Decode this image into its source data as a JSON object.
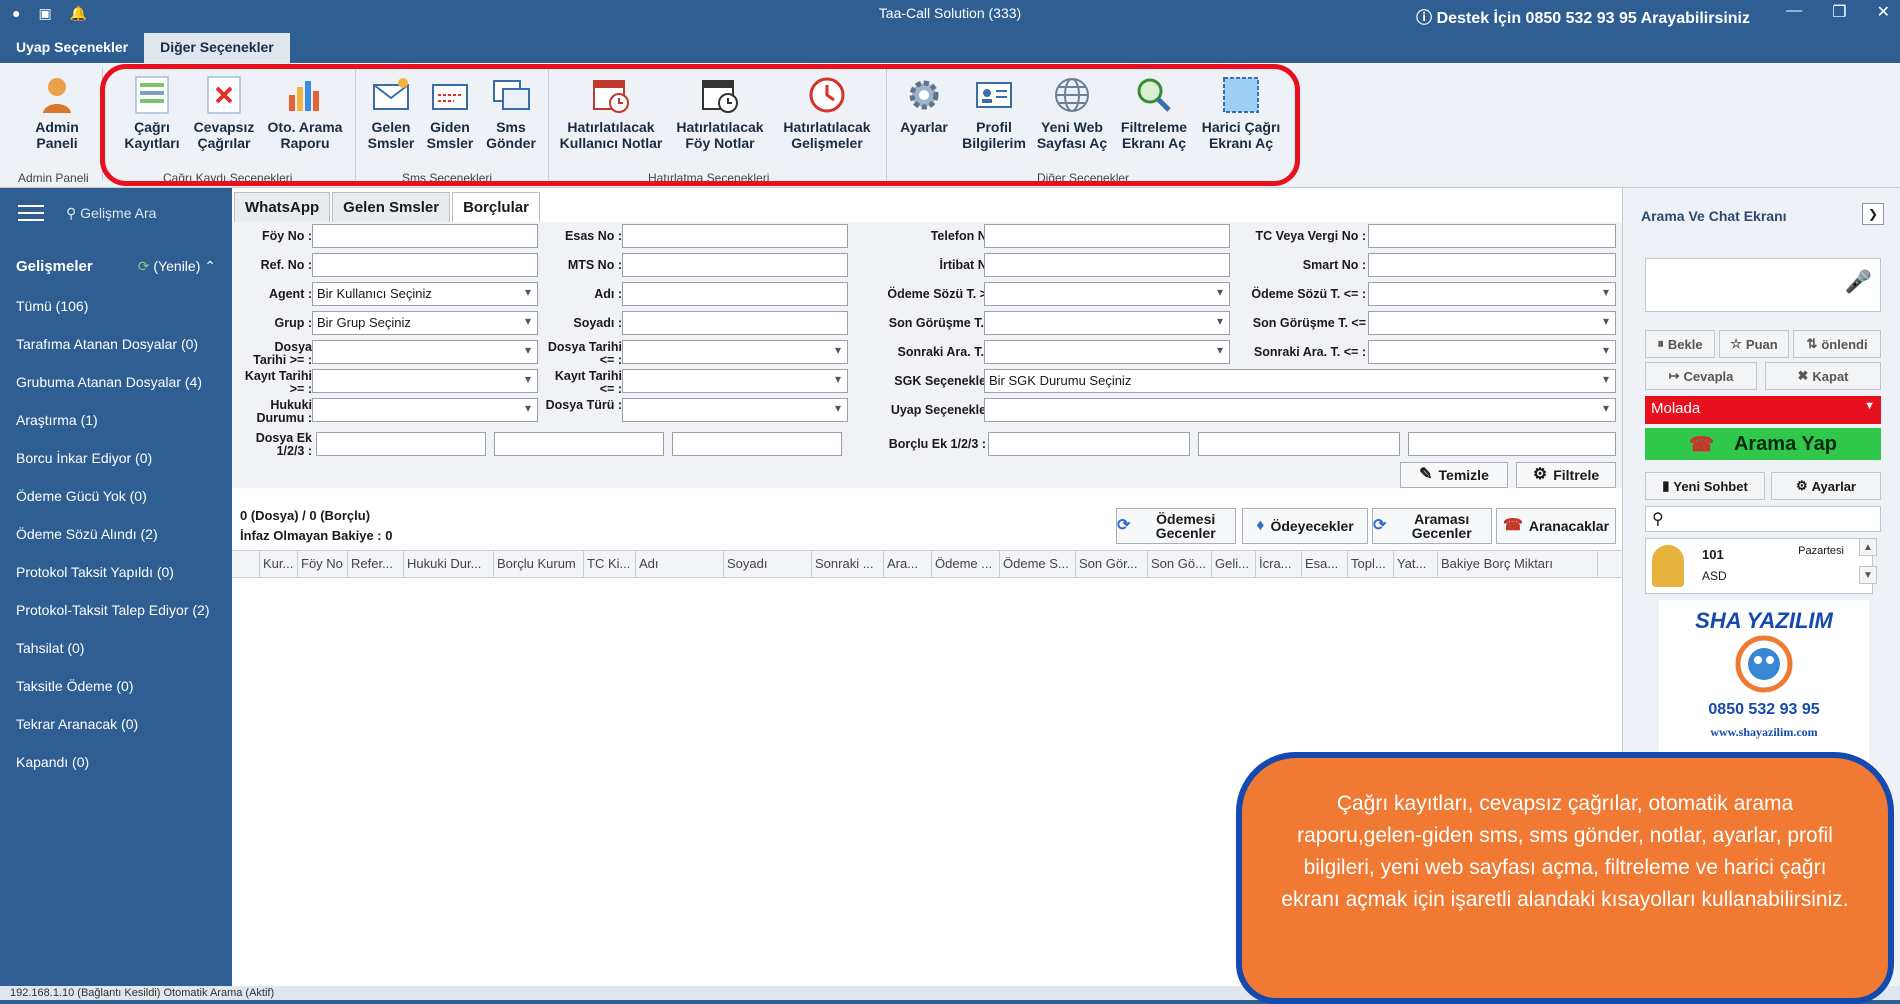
{
  "titlebar": {
    "title": "Taa-Call Solution (333)",
    "support": "Destek İçin 0850 532 93 95 Arayabilirsiniz",
    "support_icon": "info-icon"
  },
  "menu_tabs": [
    {
      "label": "Uyap Seçenekler",
      "active": false
    },
    {
      "label": "Diğer Seçenekler",
      "active": true
    }
  ],
  "ribbon": {
    "buttons": [
      {
        "label": "Admin Paneli",
        "icon": "admin-icon"
      },
      {
        "label": "Çağrı Kayıtları",
        "icon": "call-log-icon"
      },
      {
        "label": "Cevapsız Çağrılar",
        "icon": "missed-call-icon"
      },
      {
        "label": "Oto. Arama Raporu",
        "icon": "bar-chart-icon"
      },
      {
        "label": "Gelen Smsler",
        "icon": "inbox-mail-icon"
      },
      {
        "label": "Giden Smsler",
        "icon": "outbox-mail-icon"
      },
      {
        "label": "Sms Gönder",
        "icon": "send-sms-icon"
      },
      {
        "label": "Hatırlatılacak Kullanıcı Notlar",
        "icon": "calendar-clock-icon"
      },
      {
        "label": "Hatırlatılacak Föy Notlar",
        "icon": "calendar-icon"
      },
      {
        "label": "Hatırlatılacak Gelişmeler",
        "icon": "clock-icon"
      },
      {
        "label": "Ayarlar",
        "icon": "gear-icon"
      },
      {
        "label": "Profil Bilgilerim",
        "icon": "profile-card-icon"
      },
      {
        "label": "Yeni Web Sayfası Aç",
        "icon": "globe-icon"
      },
      {
        "label": "Filtreleme Ekranı Aç",
        "icon": "magnifier-icon"
      },
      {
        "label": "Harici Çağrı Ekranı Aç",
        "icon": "window-icon"
      }
    ],
    "groups": [
      "Admin Paneli",
      "Çağrı Kaydı Seçenekleri",
      "Sms Seçenekleri",
      "Hatırlatma Seçenekleri",
      "Diğer Seçenekler"
    ]
  },
  "sidebar": {
    "search": "Gelişme Ara",
    "heading": "Gelişmeler",
    "refresh": "(Yenile)",
    "items": [
      "Tümü (106)",
      "Tarafıma Atanan Dosyalar (0)",
      "Grubuma Atanan Dosyalar (4)",
      "Araştırma (1)",
      "Borcu İnkar Ediyor (0)",
      "Ödeme Gücü Yok (0)",
      "Ödeme Sözü Alındı (2)",
      "Protokol Taksit Yapıldı (0)",
      "Protokol-Taksit Talep Ediyor (2)",
      "Tahsilat (0)",
      "Taksitle Ödeme (0)",
      "Tekrar Aranacak (0)",
      "Kapandı (0)"
    ]
  },
  "main_tabs": [
    "WhatsApp",
    "Gelen Smsler",
    "Borçlular"
  ],
  "form": {
    "foy_no": "Föy No :",
    "esas_no": "Esas No :",
    "telefon_no": "Telefon No :",
    "tc_vergi": "TC Veya Vergi No :",
    "ref_no": "Ref. No :",
    "mts_no": "MTS No :",
    "irtibat_no": "İrtibat No :",
    "smart_no": "Smart No :",
    "agent": "Agent :",
    "agent_value": "Bir Kullanıcı Seçiniz",
    "adi": "Adı :",
    "odeme_sozu_gte": "Ödeme Sözü T. >= :",
    "odeme_sozu_lte": "Ödeme Sözü T. <= :",
    "grup": "Grup :",
    "grup_value": "Bir Grup Seçiniz",
    "soyadi": "Soyadı :",
    "son_gorusme_gte": "Son Görüşme T. >=",
    "son_gorusme_lte": "Son Görüşme T. <=",
    "dosya_tarihi_gte": "Dosya Tarihi >= :",
    "dosya_tarihi_lte": "Dosya Tarihi <= :",
    "sonraki_ara_gte": "Sonraki Ara. T. >=",
    "sonraki_ara_lte": "Sonraki Ara. T. <= :",
    "kayit_tarihi_gte": "Kayıt Tarihi >= :",
    "kayit_tarihi_lte": "Kayıt Tarihi <= :",
    "sgk": "SGK Seçenekleri :",
    "sgk_value": "Bir SGK Durumu Seçiniz",
    "hukuki_durumu": "Hukuki Durumu :",
    "dosya_turu": "Dosya Türü :",
    "uyap": "Uyap Seçenekleri :",
    "dosya_ek": "Dosya Ek 1/2/3 :",
    "borclu_ek": "Borçlu Ek 1/2/3 :",
    "temizle": "Temizle",
    "filtrele": "Filtrele"
  },
  "summary": {
    "counts": "0 (Dosya) / 0 (Borçlu)",
    "balance": "İnfaz Olmayan Bakiye : 0"
  },
  "actions": [
    "Ödemesi Gecenler",
    "Ödeyecekler",
    "Araması Gecenler",
    "Aranacaklar"
  ],
  "grid_columns": [
    "Kur...",
    "Föy No",
    "Refer...",
    "Hukuki Dur...",
    "Borçlu Kurum",
    "TC Ki...",
    "Adı",
    "Soyadı",
    "Sonraki ...",
    "Ara...",
    "Ödeme ...",
    "Ödeme S...",
    "Son Gör...",
    "Son Gö...",
    "Geli...",
    "İcra...",
    "Esa...",
    "Topl...",
    "Yat...",
    "Bakiye Borç Miktarı"
  ],
  "right_panel": {
    "title": "Arama Ve Chat Ekranı",
    "bekle": "Bekle",
    "puan": "Puan",
    "onlendi": "önlendi",
    "cevapla": "Cevapla",
    "kapat": "Kapat",
    "status": "Molada",
    "call": "Arama Yap",
    "yeni_sohbet": "Yeni Sohbet",
    "ayarlar": "Ayarlar",
    "user_no": "101",
    "user_day": "Pazartesi",
    "user_name": "ASD",
    "logo_text": "SHA YAZILIM",
    "logo_phone": "0850 532 93 95",
    "logo_web": "www.shayazilim.com"
  },
  "statusbar": "192.168.1.10 (Bağlantı Kesildi) Otomatik Arama (Aktif)",
  "callout": "Çağrı kayıtları, cevapsız çağrılar, otomatik arama raporu,gelen-giden sms, sms gönder, notlar, ayarlar, profil bilgileri, yeni web sayfası açma, filtreleme ve harici çağrı ekranı açmak için işaretli alandaki kısayolları kullanabilirsiniz.",
  "colors": {
    "accent": "#2f5e93",
    "highlight": "#e8101e",
    "callout": "#f07a33",
    "callout_border": "#1449b0",
    "call_green": "#2fc84a"
  }
}
